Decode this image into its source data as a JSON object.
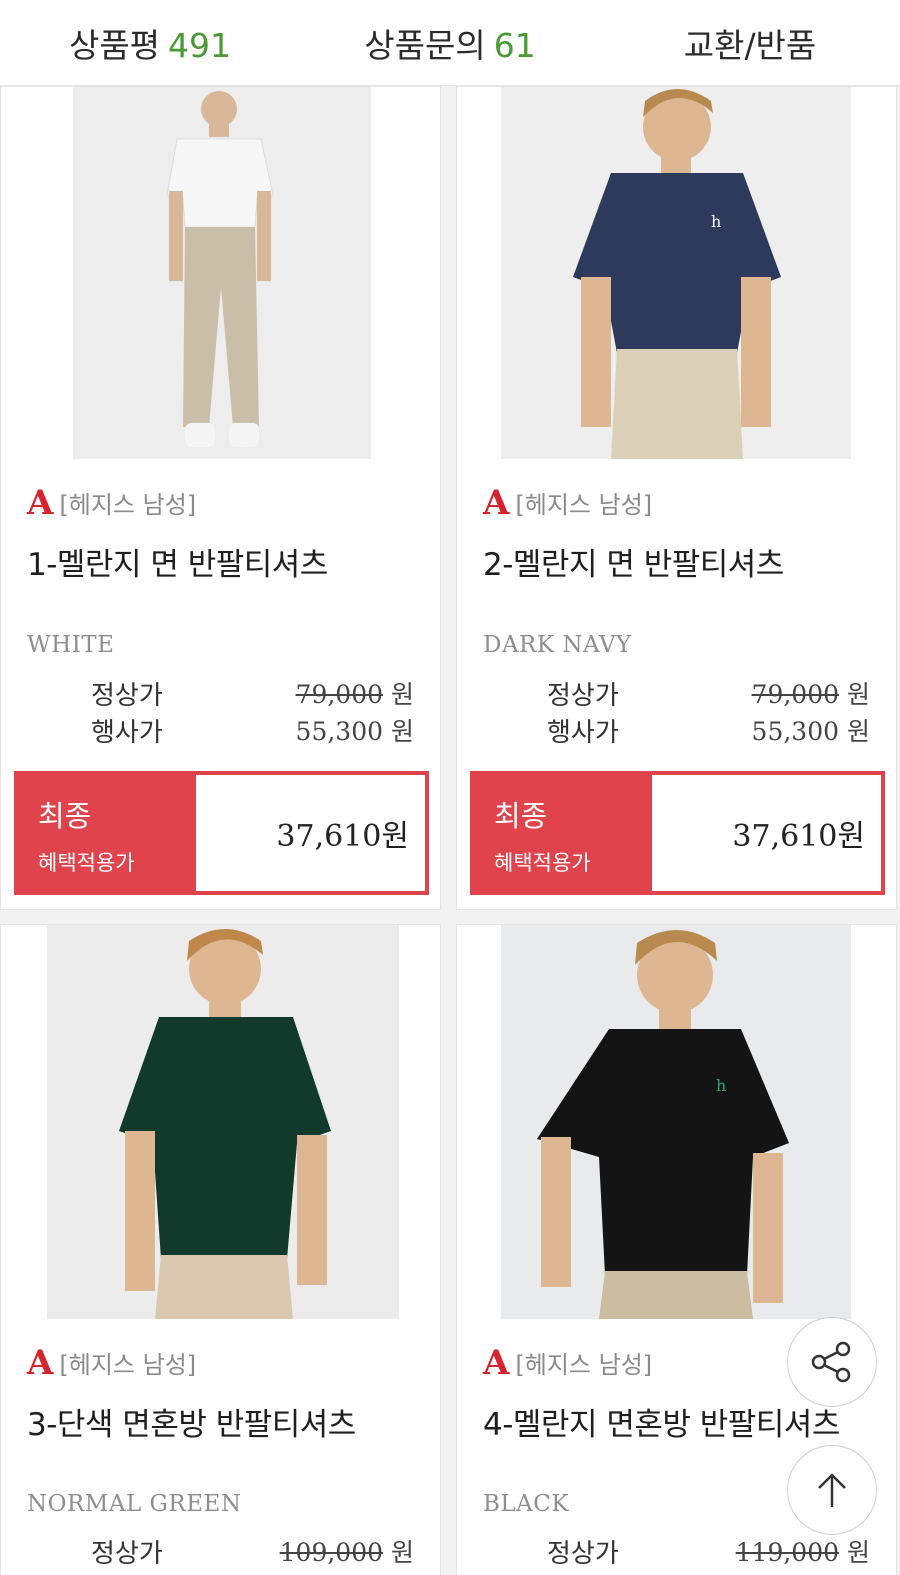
{
  "tabs": [
    {
      "label": "상품평",
      "count": "491"
    },
    {
      "label": "상품문의",
      "count": "61"
    },
    {
      "label": "교환/반품",
      "count": ""
    }
  ],
  "products": [
    {
      "brand_logo": "A",
      "brand": "[헤지스 남성]",
      "title": "1-멜란지 면 반팔티셔츠",
      "color": "WHITE",
      "regular_label": "정상가",
      "regular_price": "79,000",
      "sale_label": "행사가",
      "sale_price": "55,300",
      "currency": "원",
      "final_label_1": "최종",
      "final_label_2": "혜택적용가",
      "final_price": "37,610원",
      "shirt_color": "#f7f7f7",
      "pants_color": "#c9bfa8"
    },
    {
      "brand_logo": "A",
      "brand": "[헤지스 남성]",
      "title": "2-멜란지 면 반팔티셔츠",
      "color": "DARK NAVY",
      "regular_label": "정상가",
      "regular_price": "79,000",
      "sale_label": "행사가",
      "sale_price": "55,300",
      "currency": "원",
      "final_label_1": "최종",
      "final_label_2": "혜택적용가",
      "final_price": "37,610원",
      "shirt_color": "#2d3a5c",
      "pants_color": "#dccfb8"
    },
    {
      "brand_logo": "A",
      "brand": "[헤지스 남성]",
      "title": "3-단색 면혼방 반팔티셔츠",
      "color": "NORMAL GREEN",
      "regular_label": "정상가",
      "regular_price": "109,000",
      "currency": "원",
      "shirt_color": "#123a2c",
      "pants_color": "#d8c9b0"
    },
    {
      "brand_logo": "A",
      "brand": "[헤지스 남성]",
      "title": "4-멜란지 면혼방 반팔티셔츠",
      "color": "BLACK",
      "regular_label": "정상가",
      "regular_price": "119,000",
      "currency": "원",
      "shirt_color": "#141414",
      "pants_color": "#cbbd9f"
    }
  ],
  "fabs": {
    "share_icon": "share-icon",
    "top_icon": "arrow-up-icon"
  },
  "colors": {
    "accent_red": "#e0434b",
    "count_green": "#4a9a36",
    "brand_red": "#d7232d"
  }
}
